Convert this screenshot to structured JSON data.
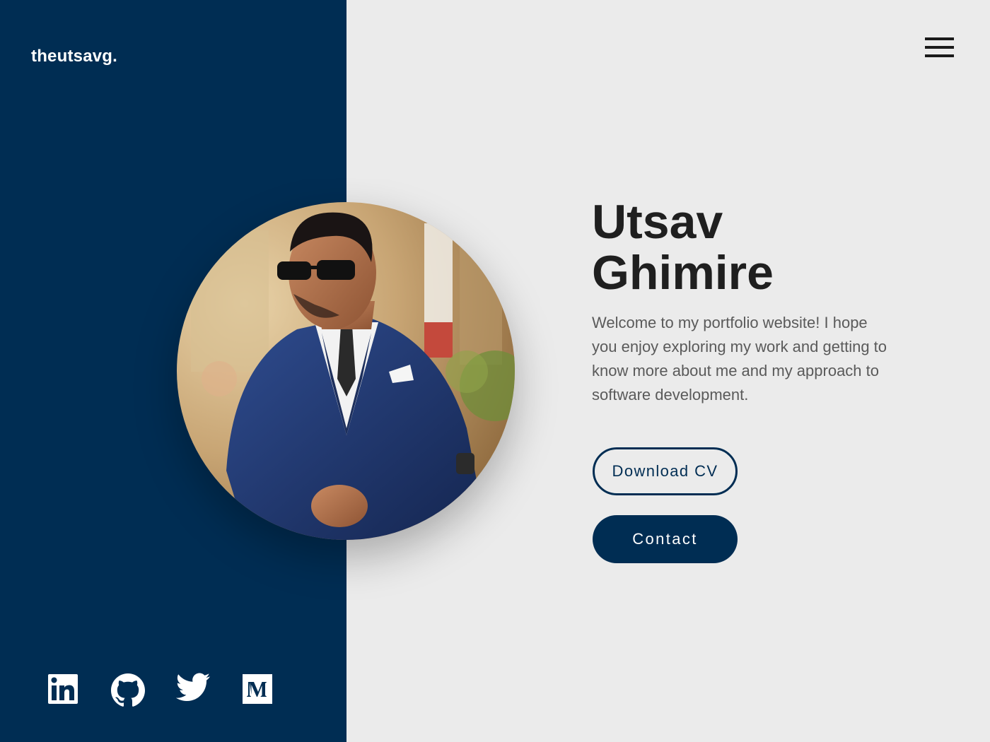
{
  "header": {
    "logo_text": "theutsavg.",
    "menu_icon": "hamburger-menu-icon"
  },
  "hero": {
    "name_line1": "Utsav",
    "name_line2": "Ghimire",
    "intro": "Welcome to my portfolio website! I hope you enjoy exploring my work and getting to know more about me and my approach to software development.",
    "download_cv_label": "Download CV",
    "contact_label": "Contact",
    "portrait_image": "profile-photo"
  },
  "social_links": [
    {
      "name": "LinkedIn",
      "icon": "linkedin-icon"
    },
    {
      "name": "GitHub",
      "icon": "github-icon"
    },
    {
      "name": "Twitter",
      "icon": "twitter-icon"
    },
    {
      "name": "Medium",
      "icon": "medium-icon"
    }
  ],
  "colors": {
    "primary_navy": "#002d53",
    "background": "#ebebeb",
    "heading_text": "#1f1f1f",
    "body_text": "#5a5a5a",
    "white": "#ffffff"
  }
}
